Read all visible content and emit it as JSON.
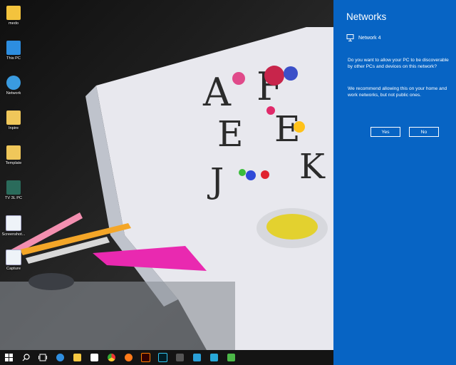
{
  "desktop": {
    "icons": [
      {
        "label": "medo",
        "icon": "user-folder-icon"
      },
      {
        "label": "This PC",
        "icon": "computer-icon"
      },
      {
        "label": "Network",
        "icon": "network-icon"
      },
      {
        "label": "Inpire",
        "icon": "folder-icon"
      },
      {
        "label": "Template",
        "icon": "chrome-folder-icon"
      },
      {
        "label": "TV 3L PC",
        "icon": "app-icon"
      },
      {
        "label": "Screenshot...",
        "icon": "image-file-icon"
      },
      {
        "label": "Capture",
        "icon": "image-file-icon"
      }
    ]
  },
  "networks_panel": {
    "title": "Networks",
    "network_name": "Network  4",
    "question": "Do you want to allow your PC to be discoverable by other PCs and devices on this network?",
    "recommendation": "We recommend allowing this on your home and work networks, but not public ones.",
    "yes_label": "Yes",
    "no_label": "No"
  },
  "taskbar": {
    "items": [
      "start-icon",
      "search-icon",
      "task-view-icon",
      "edge-icon",
      "file-explorer-icon",
      "store-icon",
      "chrome-icon",
      "firefox-icon",
      "illustrator-icon",
      "photoshop-icon",
      "app-icon",
      "shortcut-icon",
      "upload-icon",
      "camtasia-icon"
    ]
  },
  "colors": {
    "panel": "#0764c4",
    "taskbar": "#141414"
  }
}
